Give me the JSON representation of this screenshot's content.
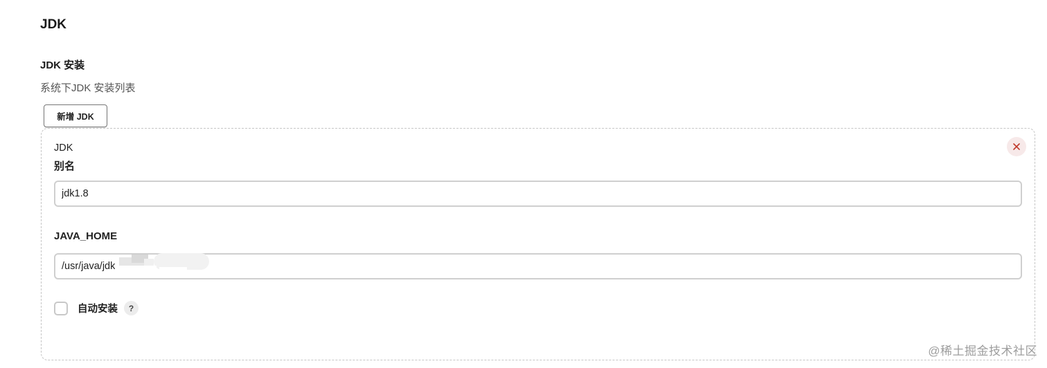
{
  "section": {
    "title": "JDK"
  },
  "installations": {
    "label": "JDK 安装",
    "description": "系统下JDK 安装列表",
    "add_button_label": "新增 JDK"
  },
  "jdk_entry": {
    "header": "JDK",
    "alias_label": "别名",
    "alias_value": "jdk1.8",
    "java_home_label": "JAVA_HOME",
    "java_home_value": "/usr/java/jdk",
    "auto_install_label": "自动安装",
    "auto_install_checked": false,
    "help_glyph": "?",
    "close_icon": "close-icon",
    "close_icon_color": "#c0392b"
  },
  "watermark": "@稀土掘金技术社区"
}
